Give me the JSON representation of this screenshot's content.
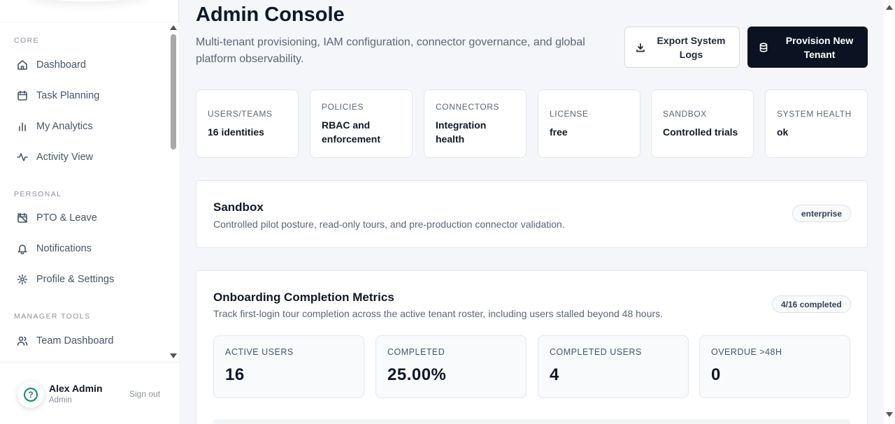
{
  "sidebar": {
    "sections": [
      {
        "label": "CORE",
        "items": [
          {
            "label": "Dashboard",
            "icon": "home-icon"
          },
          {
            "label": "Task Planning",
            "icon": "calendar-icon"
          },
          {
            "label": "My Analytics",
            "icon": "bar-chart-icon"
          },
          {
            "label": "Activity View",
            "icon": "activity-icon"
          }
        ]
      },
      {
        "label": "PERSONAL",
        "items": [
          {
            "label": "PTO & Leave",
            "icon": "calendar-off-icon"
          },
          {
            "label": "Notifications",
            "icon": "bell-icon"
          },
          {
            "label": "Profile & Settings",
            "icon": "gear-icon"
          }
        ]
      },
      {
        "label": "MANAGER TOOLS",
        "items": [
          {
            "label": "Team Dashboard",
            "icon": "users-icon"
          }
        ]
      }
    ],
    "user": {
      "name": "Alex Admin",
      "role": "Admin",
      "sign_out": "Sign out",
      "help_glyph": "?"
    }
  },
  "header": {
    "title": "Admin Console",
    "subtitle": "Multi-tenant provisioning, IAM configuration, connector governance, and global platform observability.",
    "export_button": "Export System Logs",
    "provision_button": "Provision New Tenant"
  },
  "stats": [
    {
      "key": "USERS/TEAMS",
      "value": "16 identities"
    },
    {
      "key": "POLICIES",
      "value": "RBAC and enforcement"
    },
    {
      "key": "CONNECTORS",
      "value": "Integration health"
    },
    {
      "key": "LICENSE",
      "value": "free"
    },
    {
      "key": "SANDBOX",
      "value": "Controlled trials"
    },
    {
      "key": "SYSTEM HEALTH",
      "value": "ok"
    }
  ],
  "sandbox": {
    "title": "Sandbox",
    "description": "Controlled pilot posture, read-only tours, and pre-production connector validation.",
    "badge": "enterprise"
  },
  "onboarding": {
    "title": "Onboarding Completion Metrics",
    "description": "Track first-login tour completion across the active tenant roster, including users stalled beyond 48 hours.",
    "badge": "4/16 completed",
    "metrics": [
      {
        "key": "ACTIVE USERS",
        "value": "16"
      },
      {
        "key": "COMPLETED",
        "value": "25.00%"
      },
      {
        "key": "COMPLETED USERS",
        "value": "4"
      },
      {
        "key": "OVERDUE >48H",
        "value": "0"
      }
    ]
  },
  "colors": {
    "accent_dark": "#0b1221",
    "help_green": "#0f8a6a",
    "muted_text": "#5b6677"
  }
}
